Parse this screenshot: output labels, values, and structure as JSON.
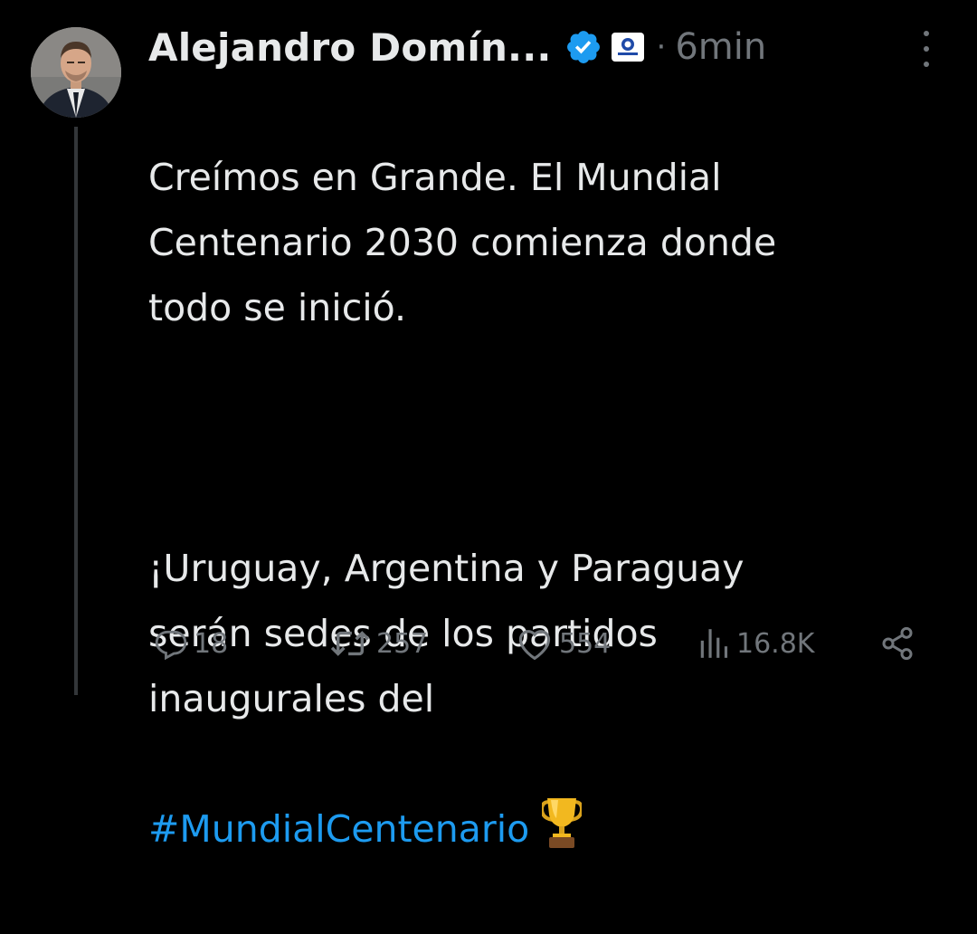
{
  "tweet": {
    "author": {
      "name": "Alejandro Domín...",
      "verified": true,
      "affiliation_badge": "CONMEBOL"
    },
    "separator": "·",
    "timestamp": "6min",
    "body": {
      "paragraph1": "Creímos en Grande. El Mundial\nCentenario 2030 comienza donde\ntodo se inició.",
      "paragraph2": "¡Uruguay, Argentina y Paraguay\nserán sedes de los partidos\ninaugurales del",
      "hashtag": "#MundialCentenario",
      "emoji": "trophy-icon"
    },
    "actions": {
      "replies": "18",
      "reposts": "257",
      "likes": "554",
      "views": "16.8K"
    }
  },
  "colors": {
    "background": "#000000",
    "text": "#e7e9ea",
    "muted": "#71767b",
    "link": "#1d9bf0",
    "verified": "#1d9bf0",
    "thread_line": "#333639"
  }
}
